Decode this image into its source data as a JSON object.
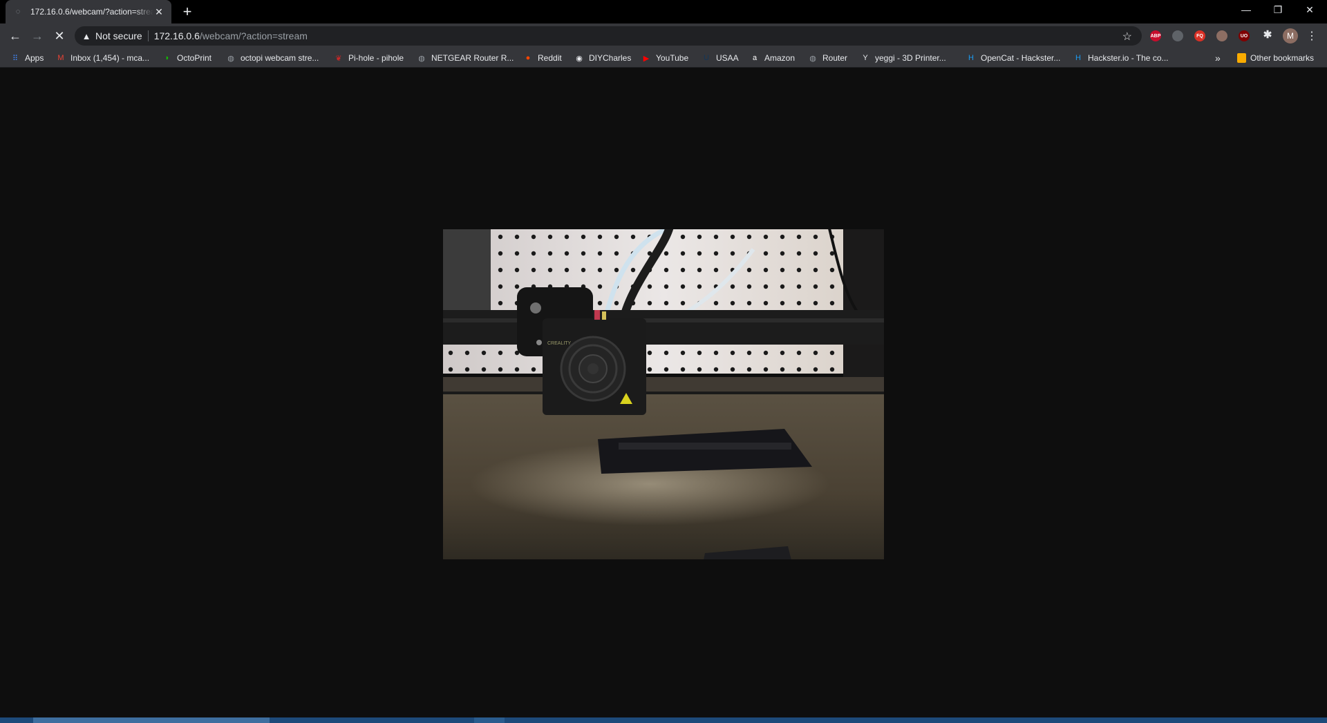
{
  "browser": {
    "tab": {
      "title": "172.16.0.6/webcam/?action=stream"
    },
    "address": {
      "security_label": "Not secure",
      "url_host": "172.16.0.6",
      "url_path": "/webcam/?action=stream"
    },
    "extensions": [
      {
        "name": "abp-icon",
        "text": "ABP",
        "color": "#c70d2c"
      },
      {
        "name": "tabs-icon",
        "text": "",
        "color": "#5f6368"
      },
      {
        "name": "fq-icon",
        "text": "FQ",
        "color": "#d93025"
      },
      {
        "name": "hand-icon",
        "text": "",
        "color": "#8d6e63"
      },
      {
        "name": "ublock-icon",
        "text": "UO",
        "color": "#800000"
      }
    ],
    "profile_initial": "M"
  },
  "bookmarks": {
    "items": [
      {
        "label": "Apps",
        "icon": "apps-grid-icon",
        "color": "#4285f4"
      },
      {
        "label": "Inbox (1,454) - mca...",
        "icon": "gmail-icon",
        "color": "#ea4335"
      },
      {
        "label": "OctoPrint",
        "icon": "octoprint-icon",
        "color": "#13c100"
      },
      {
        "label": "octopi webcam stre...",
        "icon": "globe-icon",
        "color": "#9aa0a6"
      },
      {
        "label": "Pi-hole - pihole",
        "icon": "pihole-icon",
        "color": "#c62828"
      },
      {
        "label": "NETGEAR Router R...",
        "icon": "globe-icon",
        "color": "#9aa0a6"
      },
      {
        "label": "Reddit",
        "icon": "reddit-icon",
        "color": "#ff4500"
      },
      {
        "label": "DIYCharles",
        "icon": "github-icon",
        "color": "#e8eaed"
      },
      {
        "label": "YouTube",
        "icon": "youtube-icon",
        "color": "#ff0000"
      },
      {
        "label": "USAA",
        "icon": "usaa-icon",
        "color": "#12365a"
      },
      {
        "label": "Amazon",
        "icon": "amazon-icon",
        "color": "#ffffff"
      },
      {
        "label": "Router",
        "icon": "globe-icon",
        "color": "#9aa0a6"
      },
      {
        "label": "yeggi - 3D Printer...",
        "icon": "yeggi-icon",
        "color": "#e8eaed"
      },
      {
        "label": "OpenCat - Hackster...",
        "icon": "hackster-icon",
        "color": "#1c9bf0"
      },
      {
        "label": "Hackster.io - The co...",
        "icon": "hackster-icon",
        "color": "#1c9bf0"
      }
    ],
    "overflow": "»",
    "other": "Other bookmarks"
  },
  "stream": {
    "brand_text": "CREALITY"
  }
}
